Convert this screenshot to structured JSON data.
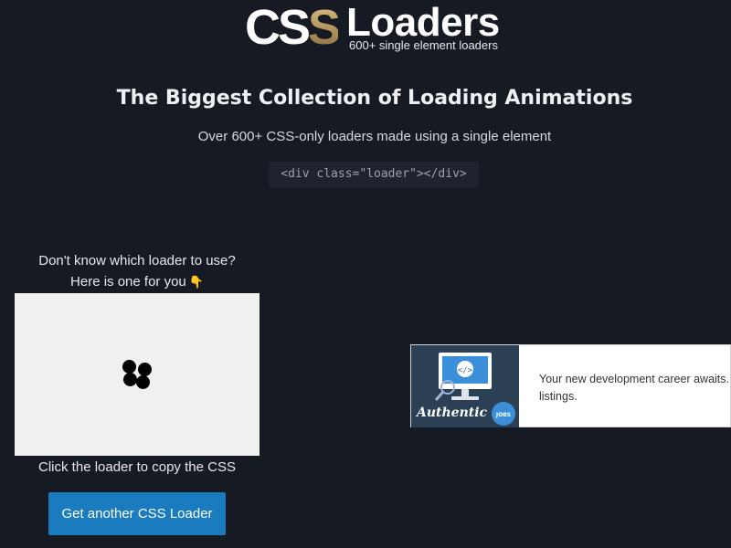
{
  "header": {
    "logo_css": "CS",
    "logo_css_s": "S",
    "logo_loaders": "Loaders",
    "logo_subtitle": "600+ single element loaders"
  },
  "hero": {
    "headline": "The Biggest Collection of Loading Animations",
    "subline": "Over 600+ CSS-only loaders made using a single element",
    "code": "<div class=\"loader\"></div>"
  },
  "picker": {
    "question": "Don't know which loader to use?",
    "offer": "Here is one for you",
    "offer_icon": "pointing-down-hand-icon",
    "hint": "Click the loader to copy the CSS",
    "button_label": "Get another CSS Loader"
  },
  "ad": {
    "image_text": "Authentic",
    "badge_text": "JOBS",
    "text": "Your new development career awaits. listings."
  },
  "colors": {
    "background": "#161a23",
    "button": "#1a7bbf",
    "loader_bg": "#f0f0f0",
    "accent_gold": "#c9a56b"
  }
}
